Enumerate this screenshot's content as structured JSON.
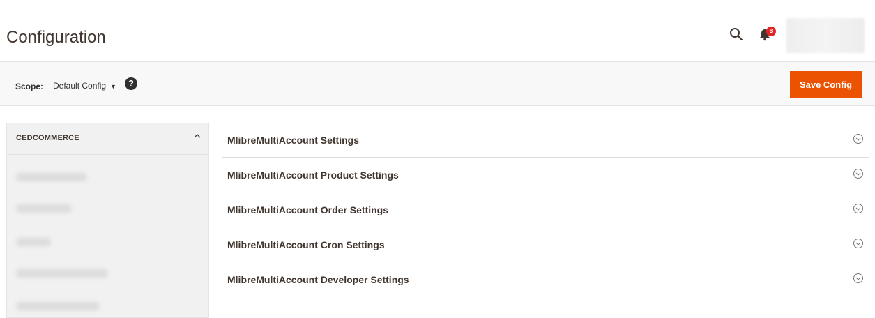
{
  "header": {
    "page_title": "Configuration",
    "notifications_count": "8",
    "icons": {
      "search": "search-icon",
      "notifications": "bell-icon",
      "help": "help-icon"
    }
  },
  "scope": {
    "label": "Scope:",
    "selected": "Default Config",
    "help_glyph": "?",
    "save_label": "Save Config"
  },
  "sidebar": {
    "title": "CEDCOMMERCE"
  },
  "sections": [
    {
      "title": "MlibreMultiAccount Settings"
    },
    {
      "title": "MlibreMultiAccount Product Settings"
    },
    {
      "title": "MlibreMultiAccount Order Settings"
    },
    {
      "title": "MlibreMultiAccount Cron Settings"
    },
    {
      "title": "MlibreMultiAccount Developer Settings"
    }
  ],
  "colors": {
    "accent": "#eb5202",
    "badge": "#e22626",
    "text": "#41362f"
  }
}
